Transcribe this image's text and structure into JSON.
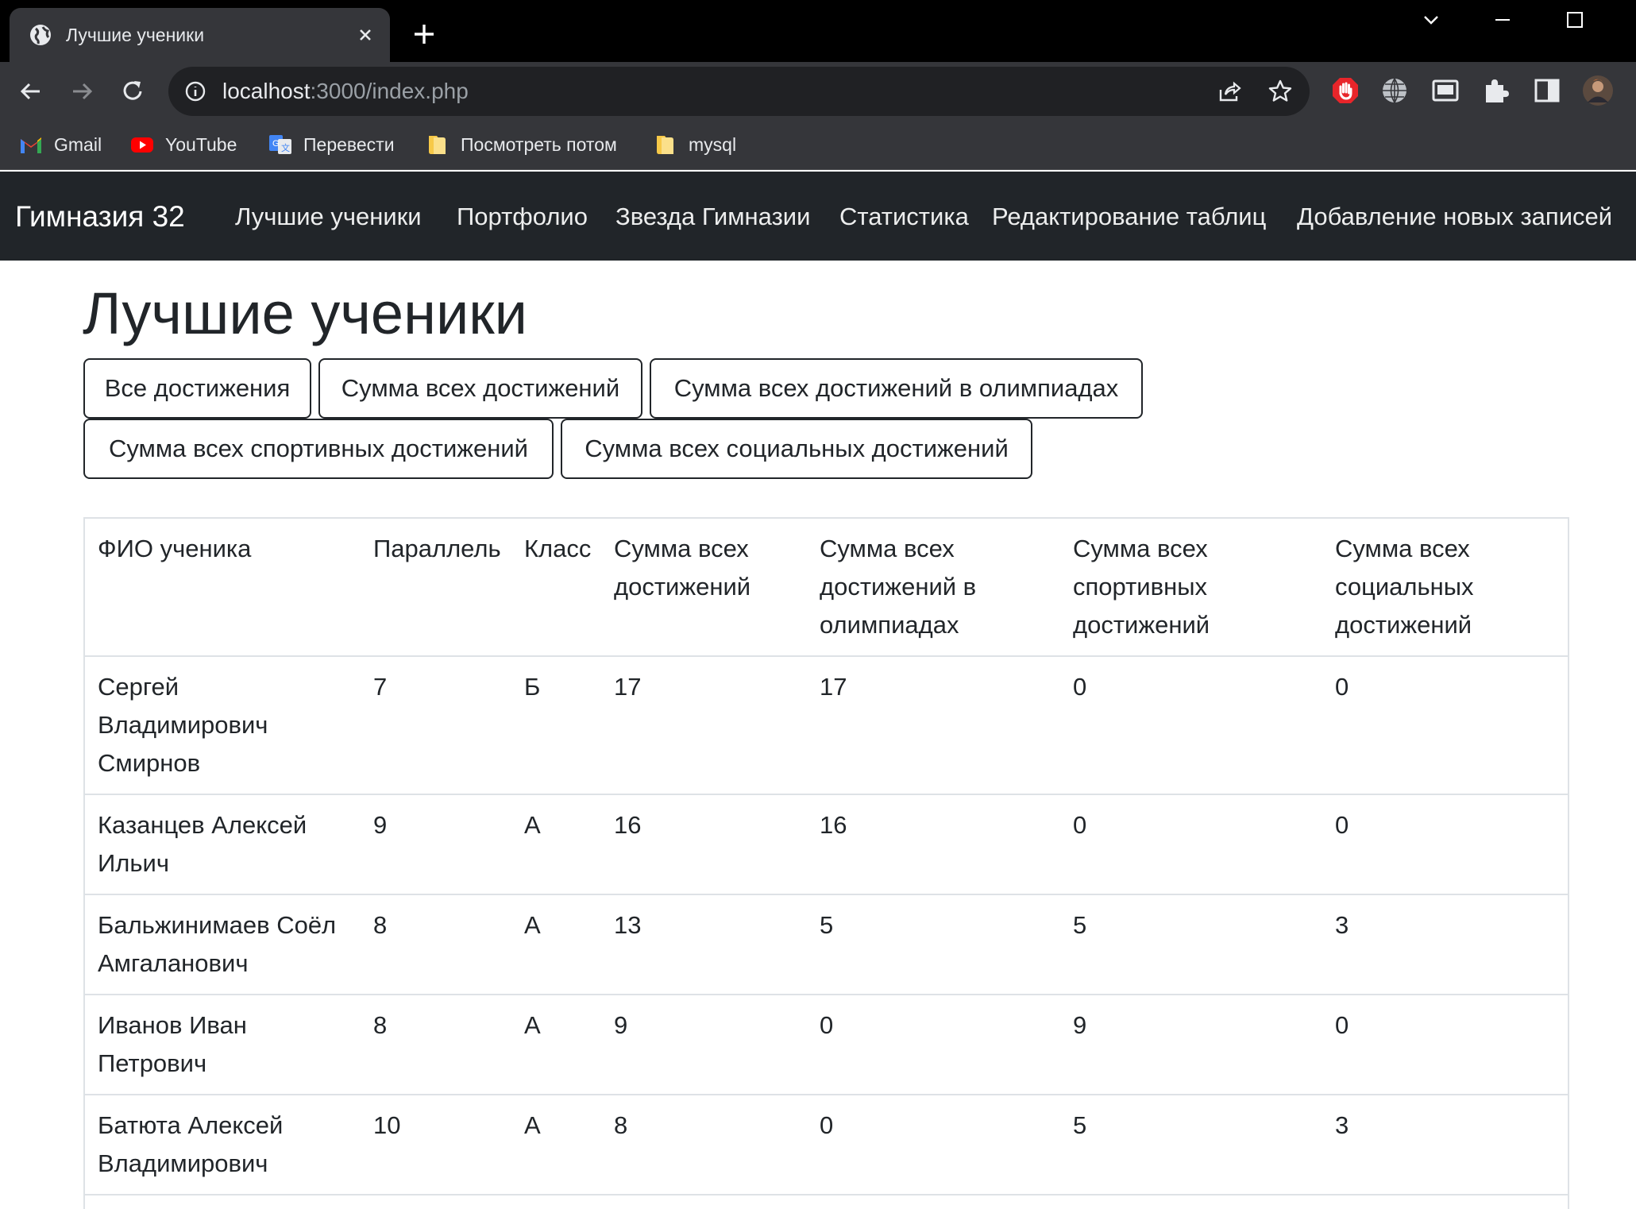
{
  "browser": {
    "tab_title": "Лучшие ученики",
    "url_host": "localhost",
    "url_path": ":3000/index.php",
    "bookmarks": [
      "Gmail",
      "YouTube",
      "Перевести",
      "Посмотреть потом",
      "mysql"
    ]
  },
  "navbar": {
    "brand": "Гимназия 32",
    "links": [
      "Лучшие ученики",
      "Портфолио",
      "Звезда Гимназии",
      "Статистика",
      "Редактирование таблиц",
      "Добавление новых записей"
    ]
  },
  "page": {
    "title": "Лучшие ученики",
    "buttons": [
      "Все достижения",
      "Сумма всех достижений",
      "Сумма всех достижений в олимпиадах",
      "Сумма всех спортивных достижений",
      "Сумма всех социальных достижений"
    ]
  },
  "table": {
    "headers": [
      "ФИО ученика",
      "Параллель",
      "Класс",
      "Сумма всех достижений",
      "Сумма всех достижений в олимпиадах",
      "Сумма всех спортивных достижений",
      "Сумма всех социальных достижений"
    ],
    "rows": [
      [
        "Сергей Владимирович Смирнов",
        "7",
        "Б",
        "17",
        "17",
        "0",
        "0"
      ],
      [
        "Казанцев Алексей Ильич",
        "9",
        "А",
        "16",
        "16",
        "0",
        "0"
      ],
      [
        "Бальжинимаев Соёл Амгаланович",
        "8",
        "А",
        "13",
        "5",
        "5",
        "3"
      ],
      [
        "Иванов Иван Петрович",
        "8",
        "А",
        "9",
        "0",
        "9",
        "0"
      ],
      [
        "Батюта Алексей Владимирович",
        "10",
        "А",
        "8",
        "0",
        "5",
        "3"
      ]
    ]
  }
}
